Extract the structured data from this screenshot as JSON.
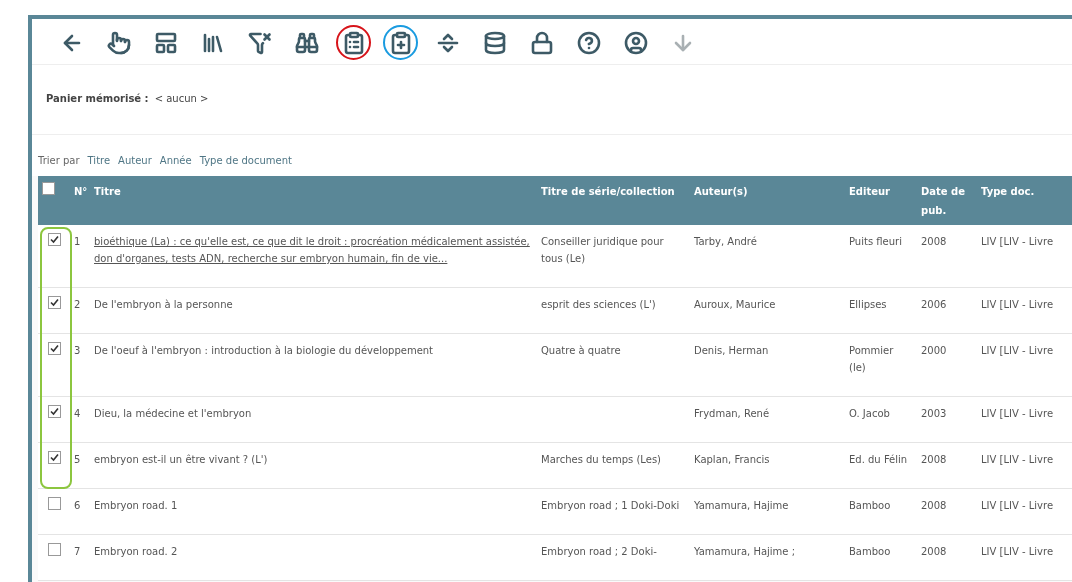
{
  "toolbar": [
    {
      "disabled": false
    },
    {
      "disabled": false
    },
    {
      "disabled": false
    },
    {
      "disabled": false
    },
    {
      "disabled": false
    },
    {
      "disabled": false
    },
    {
      "disabled": false,
      "color": "#d7141a"
    },
    {
      "disabled": false,
      "color": "#1a9be0"
    },
    {
      "disabled": false
    },
    {
      "disabled": false
    },
    {
      "disabled": false
    },
    {
      "disabled": false
    },
    {
      "disabled": false
    },
    {
      "disabled": true
    }
  ],
  "basket": {
    "label": "Panier mémorisé :",
    "value": "< aucun >"
  },
  "sort": {
    "label": "Trier par",
    "options": [
      "Titre",
      "Auteur",
      "Année",
      "Type de document"
    ]
  },
  "table": {
    "select_all": {
      "checked": false
    },
    "columns": [
      "N°",
      "Titre",
      "Titre de série/collection",
      "Auteur(s)",
      "Editeur",
      "Date de pub.",
      "Type doc."
    ],
    "highlight_frame": {
      "color": "#8cc63f"
    },
    "rows": [
      {
        "checked": true,
        "hovered": true,
        "highlighted": true,
        "cells": [
          "1",
          "bioéthique (La) : ce qu'elle est, ce que dit le droit : procréation médicalement assistée, don d'organes, tests ADN, recherche sur embryon humain, fin de vie...",
          "Conseiller juridique pour tous (Le)",
          "Tarby, André",
          "Puits fleuri",
          "2008",
          "LIV [LIV - Livre"
        ]
      },
      {
        "checked": true,
        "hovered": false,
        "highlighted": true,
        "cells": [
          "2",
          "De l'embryon à la personne",
          "esprit des sciences (L')",
          "Auroux, Maurice",
          "Ellipses",
          "2006",
          "LIV [LIV - Livre"
        ]
      },
      {
        "checked": true,
        "hovered": false,
        "highlighted": true,
        "cells": [
          "3",
          "De l'oeuf à l'embryon : introduction à la biologie du développement",
          "Quatre à quatre",
          "Denis, Herman",
          "Pommier (le)",
          "2000",
          "LIV [LIV - Livre"
        ]
      },
      {
        "checked": true,
        "hovered": false,
        "highlighted": true,
        "cells": [
          "4",
          "Dieu, la médecine et l'embryon",
          "",
          "Frydman, René",
          "O. Jacob",
          "2003",
          "LIV [LIV - Livre"
        ]
      },
      {
        "checked": true,
        "hovered": false,
        "highlighted": true,
        "cells": [
          "5",
          "embryon est-il un être vivant ? (L')",
          "Marches du temps (Les)",
          "Kaplan, Francis",
          "Ed. du Félin",
          "2008",
          "LIV [LIV - Livre"
        ]
      },
      {
        "checked": false,
        "hovered": false,
        "highlighted": false,
        "cells": [
          "6",
          "Embryon road. 1",
          "Embryon road ; 1 Doki-Doki",
          "Yamamura, Hajime",
          "Bamboo",
          "2008",
          "LIV [LIV - Livre"
        ]
      },
      {
        "checked": false,
        "hovered": false,
        "highlighted": false,
        "cells": [
          "7",
          "Embryon road. 2",
          "Embryon road ; 2 Doki-",
          "Yamamura, Hajime ;",
          "Bamboo",
          "2008",
          "LIV [LIV - Livre"
        ]
      }
    ]
  }
}
